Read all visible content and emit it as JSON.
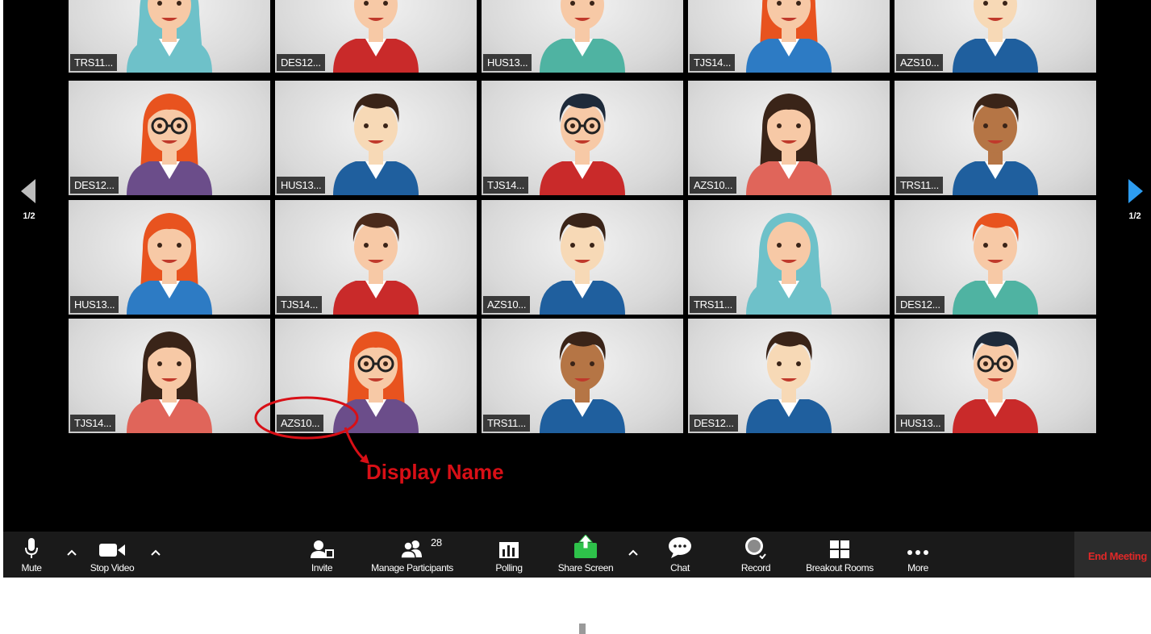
{
  "gallery": {
    "rows": [
      {
        "tiles": [
          {
            "name": "TRS11...",
            "avatar": "hijab-woman-icon",
            "skin": "#f7c9a6",
            "hair": "#6ec1c9",
            "shirt": "#6ec1c9",
            "glasses": false,
            "style": "hijab"
          },
          {
            "name": "DES12...",
            "avatar": "man-icon",
            "skin": "#f7c9a6",
            "hair": "#4a2a1b",
            "shirt": "#c92a2a",
            "glasses": false,
            "style": "man"
          },
          {
            "name": "HUS13...",
            "avatar": "red-hair-man-icon",
            "skin": "#f7c9a6",
            "hair": "#e8531f",
            "shirt": "#4fb3a2",
            "glasses": false,
            "style": "man"
          },
          {
            "name": "TJS14...",
            "avatar": "red-hair-woman-icon",
            "skin": "#f7c9a6",
            "hair": "#e8531f",
            "shirt": "#2d7bc4",
            "glasses": false,
            "style": "woman"
          },
          {
            "name": "AZS10...",
            "avatar": "man-icon",
            "skin": "#f7d9b6",
            "hair": "#3a2418",
            "shirt": "#1f5f9e",
            "glasses": false,
            "style": "man"
          }
        ]
      },
      {
        "tiles": [
          {
            "name": "DES12...",
            "avatar": "red-hair-glasses-woman-icon",
            "skin": "#f7c9a6",
            "hair": "#e8531f",
            "shirt": "#6b4d8a",
            "glasses": true,
            "style": "woman"
          },
          {
            "name": "HUS13...",
            "avatar": "man-icon",
            "skin": "#f7d9b6",
            "hair": "#3a2418",
            "shirt": "#1f5f9e",
            "glasses": false,
            "style": "man"
          },
          {
            "name": "TJS14...",
            "avatar": "glasses-man-icon",
            "skin": "#f7c9a6",
            "hair": "#1e2a3a",
            "shirt": "#c92a2a",
            "glasses": true,
            "style": "man"
          },
          {
            "name": "AZS10...",
            "avatar": "woman-icon",
            "skin": "#f7c9a6",
            "hair": "#3a2418",
            "shirt": "#e0655a",
            "glasses": false,
            "style": "woman"
          },
          {
            "name": "TRS11...",
            "avatar": "dark-skin-man-icon",
            "skin": "#b57545",
            "hair": "#3a2418",
            "shirt": "#1f5f9e",
            "glasses": false,
            "style": "man"
          }
        ]
      },
      {
        "tiles": [
          {
            "name": "HUS13...",
            "avatar": "red-hair-woman-icon",
            "skin": "#f7c9a6",
            "hair": "#e8531f",
            "shirt": "#2d7bc4",
            "glasses": false,
            "style": "woman"
          },
          {
            "name": "TJS14...",
            "avatar": "man-icon",
            "skin": "#f7c9a6",
            "hair": "#4a2a1b",
            "shirt": "#c92a2a",
            "glasses": false,
            "style": "man"
          },
          {
            "name": "AZS10...",
            "avatar": "man-icon",
            "skin": "#f7d9b6",
            "hair": "#3a2418",
            "shirt": "#1f5f9e",
            "glasses": false,
            "style": "man"
          },
          {
            "name": "TRS11...",
            "avatar": "hijab-woman-icon",
            "skin": "#f7c9a6",
            "hair": "#6ec1c9",
            "shirt": "#6ec1c9",
            "glasses": false,
            "style": "hijab"
          },
          {
            "name": "DES12...",
            "avatar": "red-hair-man-icon",
            "skin": "#f7c9a6",
            "hair": "#e8531f",
            "shirt": "#4fb3a2",
            "glasses": false,
            "style": "man"
          }
        ]
      },
      {
        "tiles": [
          {
            "name": "TJS14...",
            "avatar": "woman-icon",
            "skin": "#f7c9a6",
            "hair": "#3a2418",
            "shirt": "#e0655a",
            "glasses": false,
            "style": "woman"
          },
          {
            "name": "AZS10...",
            "avatar": "red-hair-glasses-woman-icon",
            "skin": "#f7c9a6",
            "hair": "#e8531f",
            "shirt": "#6b4d8a",
            "glasses": true,
            "style": "woman"
          },
          {
            "name": "TRS11...",
            "avatar": "dark-skin-man-icon",
            "skin": "#b57545",
            "hair": "#3a2418",
            "shirt": "#1f5f9e",
            "glasses": false,
            "style": "man"
          },
          {
            "name": "DES12...",
            "avatar": "man-icon",
            "skin": "#f7d9b6",
            "hair": "#3a2418",
            "shirt": "#1f5f9e",
            "glasses": false,
            "style": "man"
          },
          {
            "name": "HUS13...",
            "avatar": "glasses-man-icon",
            "skin": "#f7c9a6",
            "hair": "#1e2a3a",
            "shirt": "#c92a2a",
            "glasses": true,
            "style": "man"
          }
        ]
      }
    ],
    "prev_page": "1/2",
    "next_page": "1/2"
  },
  "annotation": {
    "label": "Display Name",
    "color": "#d80f16"
  },
  "toolbar": {
    "mute": "Mute",
    "stop_video": "Stop Video",
    "invite": "Invite",
    "manage_participants": "Manage Participants",
    "participant_count": "28",
    "polling": "Polling",
    "share_screen": "Share Screen",
    "chat": "Chat",
    "record": "Record",
    "breakout_rooms": "Breakout Rooms",
    "more": "More",
    "end_meeting": "End Meeting",
    "share_color": "#2ec24a",
    "end_color": "#e02828"
  }
}
